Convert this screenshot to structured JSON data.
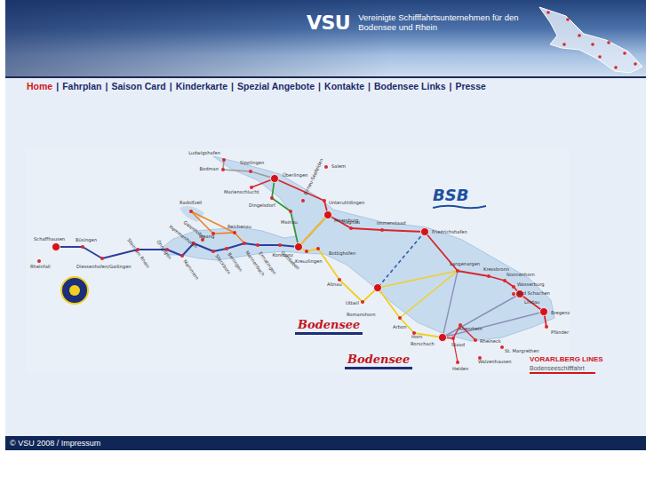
{
  "header": {
    "logo": "VSU",
    "subtitle": [
      "Vereinigte Schifffahrtsunternehmen für den",
      "Bodensee und Rhein"
    ]
  },
  "nav": {
    "separator": "|",
    "items": [
      {
        "label": "Home",
        "selected": true
      },
      {
        "label": "Fahrplan",
        "selected": false
      },
      {
        "label": "Saison Card",
        "selected": false
      },
      {
        "label": "Kinderkarte",
        "selected": false
      },
      {
        "label": "Spezial Angebote",
        "selected": false
      },
      {
        "label": "Kontakte",
        "selected": false
      },
      {
        "label": "Bodensee Links",
        "selected": false
      },
      {
        "label": "Presse",
        "selected": false
      }
    ]
  },
  "map": {
    "towns": [
      {
        "name": "Ludwigshafen",
        "major": false
      },
      {
        "name": "Sipplingen",
        "major": false
      },
      {
        "name": "Bodman",
        "major": false
      },
      {
        "name": "Überlingen",
        "major": true
      },
      {
        "name": "Salem",
        "major": false
      },
      {
        "name": "Marienschlucht",
        "major": false
      },
      {
        "name": "Birnau-Seefelden",
        "major": false
      },
      {
        "name": "Dingelsdorf",
        "major": false
      },
      {
        "name": "Unteruhldingen",
        "major": false
      },
      {
        "name": "Mainau",
        "major": false
      },
      {
        "name": "Meersburg",
        "major": true
      },
      {
        "name": "Hagnau",
        "major": false
      },
      {
        "name": "Immenstaad",
        "major": false
      },
      {
        "name": "Friedrichshafen",
        "major": true
      },
      {
        "name": "Radolfzell",
        "major": false
      },
      {
        "name": "Iznang",
        "major": false
      },
      {
        "name": "Reichenau",
        "major": false
      },
      {
        "name": "Mannenbach",
        "major": false
      },
      {
        "name": "Ermatingen",
        "major": false
      },
      {
        "name": "Gottlieben",
        "major": false
      },
      {
        "name": "Konstanz",
        "major": true
      },
      {
        "name": "Kreuzlingen",
        "major": false
      },
      {
        "name": "Bottighofen",
        "major": false
      },
      {
        "name": "Altnau",
        "major": false
      },
      {
        "name": "Uttwil",
        "major": false
      },
      {
        "name": "Romanshorn",
        "major": true
      },
      {
        "name": "Arbon",
        "major": false
      },
      {
        "name": "Horn",
        "major": false
      },
      {
        "name": "Rorschach",
        "major": true
      },
      {
        "name": "Staad",
        "major": false
      },
      {
        "name": "Altenrhein",
        "major": false
      },
      {
        "name": "Rheineck",
        "major": false
      },
      {
        "name": "Walzenhausen",
        "major": false
      },
      {
        "name": "Heiden",
        "major": false
      },
      {
        "name": "St. Margrethen",
        "major": false
      },
      {
        "name": "Langenargen",
        "major": false
      },
      {
        "name": "Kressbronn",
        "major": false
      },
      {
        "name": "Nonnenhorn",
        "major": false
      },
      {
        "name": "Wasserburg",
        "major": false
      },
      {
        "name": "Bad Schachen",
        "major": false
      },
      {
        "name": "Lindau",
        "major": true
      },
      {
        "name": "Bregenz",
        "major": true
      },
      {
        "name": "Pfänder",
        "major": false
      },
      {
        "name": "Schaffhausen",
        "major": true
      },
      {
        "name": "Rheinfall",
        "major": false
      },
      {
        "name": "Büsingen",
        "major": false
      },
      {
        "name": "Diessenhofen/Gailingen",
        "major": false
      },
      {
        "name": "Stein am Rhein",
        "major": false
      },
      {
        "name": "Öhningen",
        "major": false
      },
      {
        "name": "Mammern",
        "major": false
      },
      {
        "name": "Hemmenhofen",
        "major": false
      },
      {
        "name": "Gaienhofen",
        "major": false
      },
      {
        "name": "Steckborn",
        "major": false
      },
      {
        "name": "Berlingen",
        "major": false
      }
    ],
    "logos": [
      {
        "kind": "bsb",
        "text": "BSB"
      },
      {
        "kind": "script",
        "text": "Bodensee"
      },
      {
        "kind": "script",
        "text": "Bodensee"
      },
      {
        "kind": "vorarlberg",
        "text": "VORARLBERG LINES",
        "sub": "Bodenseeschifffahrt"
      },
      {
        "kind": "badge",
        "text": ""
      }
    ]
  },
  "footer": {
    "text": "© VSU 2008 / Impressum"
  }
}
